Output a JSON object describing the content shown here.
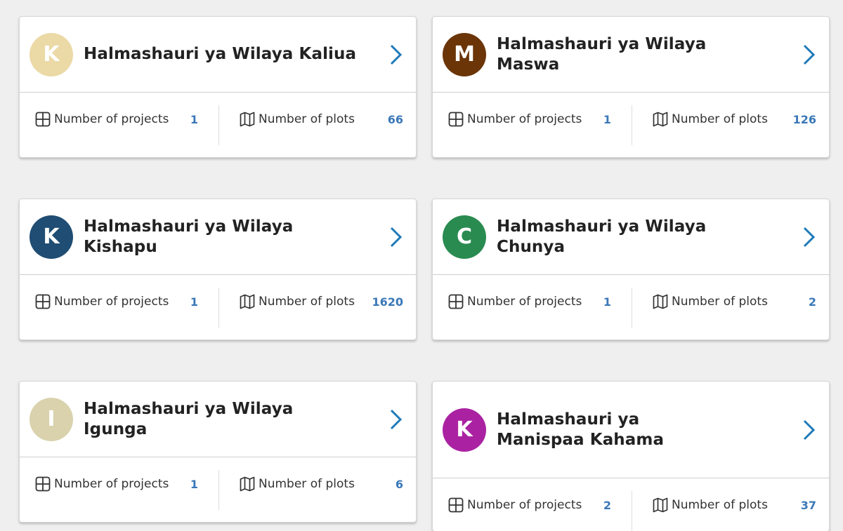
{
  "labels": {
    "projects": "Number of projects",
    "plots": "Number of plots"
  },
  "cards": [
    {
      "initial": "K",
      "avatar_color": "#ebd9a6",
      "name": "Halmashauri ya Wilaya Kaliua",
      "projects": "1",
      "plots": "66"
    },
    {
      "initial": "M",
      "avatar_color": "#6b3508",
      "name": "Halmashauri ya Wilaya Maswa",
      "projects": "1",
      "plots": "126"
    },
    {
      "initial": "K",
      "avatar_color": "#1f4d73",
      "name": "Halmashauri ya Wilaya Kishapu",
      "projects": "1",
      "plots": "1620"
    },
    {
      "initial": "C",
      "avatar_color": "#2a8b51",
      "name": "Halmashauri ya Wilaya Chunya",
      "projects": "1",
      "plots": "2"
    },
    {
      "initial": "I",
      "avatar_color": "#d9d2ad",
      "name": "Halmashauri ya Wilaya Igunga",
      "projects": "1",
      "plots": "6"
    },
    {
      "initial": "K",
      "avatar_color": "#aa22a2",
      "name": "Halmashauri ya Manispaa Kahama",
      "projects": "2",
      "plots": "37"
    }
  ],
  "colors": {
    "accent_chevron": "#1e7ab8",
    "stat_value": "#3b78b8"
  }
}
